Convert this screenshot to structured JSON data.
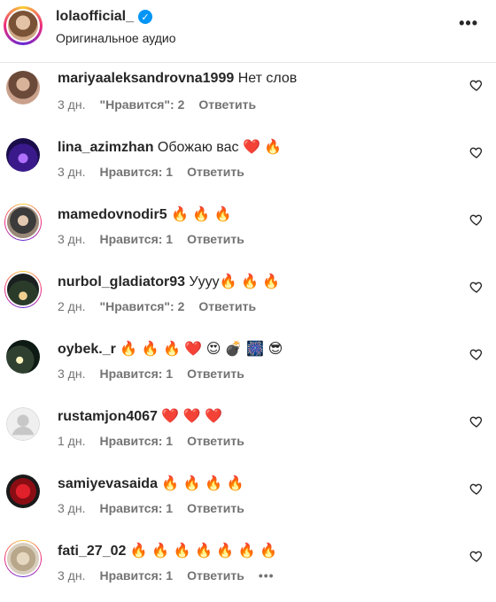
{
  "header": {
    "username": "lolaofficial_",
    "verified_icon": "verified-badge-icon",
    "subtitle": "Оригинальное аудио",
    "more_label": "•••"
  },
  "colors": {
    "text": "#262626",
    "meta": "#737373",
    "verified": "#0095f6"
  },
  "comments": [
    {
      "username": "mariyaaleksandrovna1999",
      "text": " Нет слов",
      "time": "3 дн.",
      "likes": "\"Нравится\": 2",
      "reply": "Ответить"
    },
    {
      "username": "lina_azimzhan",
      "text": " Обожаю вас ❤️ 🔥",
      "time": "3 дн.",
      "likes": "Нравится: 1",
      "reply": "Ответить"
    },
    {
      "username": "mamedovnodir5",
      "text": " 🔥 🔥 🔥",
      "time": "3 дн.",
      "likes": "Нравится: 1",
      "reply": "Ответить"
    },
    {
      "username": "nurbol_gladiator93",
      "text": " Уууу🔥 🔥 🔥",
      "time": "2 дн.",
      "likes": "\"Нравится\": 2",
      "reply": "Ответить"
    },
    {
      "username": "oybek._r",
      "text": " 🔥 🔥 🔥 ❤️ 😍 💣 🎆 😎",
      "time": "3 дн.",
      "likes": "Нравится: 1",
      "reply": "Ответить"
    },
    {
      "username": "rustamjon4067",
      "text": " ❤️ ❤️ ❤️",
      "time": "1 дн.",
      "likes": "Нравится: 1",
      "reply": "Ответить"
    },
    {
      "username": "samiyevasaida",
      "text": " 🔥 🔥 🔥 🔥",
      "time": "3 дн.",
      "likes": "Нравится: 1",
      "reply": "Ответить"
    },
    {
      "username": "fati_27_02",
      "text": " 🔥 🔥 🔥 🔥 🔥 🔥 🔥",
      "time": "3 дн.",
      "likes": "Нравится: 1",
      "reply": "Ответить",
      "more": "•••"
    }
  ]
}
